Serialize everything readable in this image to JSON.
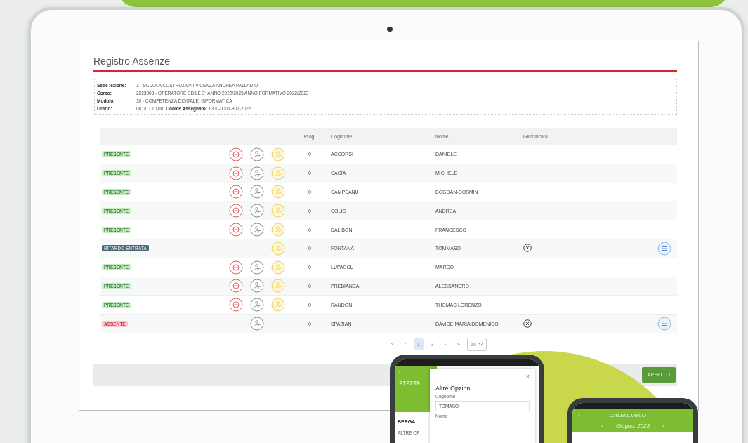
{
  "screen": {
    "title": "Registro Assenze",
    "info": [
      {
        "label": "Sede lezione:",
        "value": "1 - SCUOLA COSTRUZIONI VICENZA ANDREA PALLADIO"
      },
      {
        "label": "Corso:",
        "value": "2223003 - OPERATORE EDILE 3° ANNO 2022/2023 ANNO FORMATIVO 2022/2023"
      },
      {
        "label": "Modulo:",
        "value": "10 - COMPETENZA DIGITALE: INFORMATICA"
      },
      {
        "label": "Orario:",
        "value": "08,00 - 10,00",
        "extra_label": "Codice Assegnato:",
        "extra_value": "1300-0001-807-2022"
      }
    ]
  },
  "table": {
    "columns": [
      "Prog.",
      "Cognome",
      "Nome",
      "Giustificato"
    ],
    "rows": [
      {
        "status": "PRESENTE",
        "kind": "present",
        "remove": true,
        "attendance": true,
        "late": true,
        "prog": "0",
        "cognome": "ACCORSI",
        "nome": "DANIELE",
        "not_justified": false,
        "menu_button": false
      },
      {
        "status": "PRESENTE",
        "kind": "present",
        "remove": true,
        "attendance": true,
        "late": true,
        "prog": "0",
        "cognome": "CACIA",
        "nome": "MICHELE",
        "not_justified": false,
        "menu_button": false
      },
      {
        "status": "PRESENTE",
        "kind": "present",
        "remove": true,
        "attendance": true,
        "late": true,
        "prog": "0",
        "cognome": "CAMPEANU",
        "nome": "BOGDAN-COSMIN",
        "not_justified": false,
        "menu_button": false
      },
      {
        "status": "PRESENTE",
        "kind": "present",
        "remove": true,
        "attendance": true,
        "late": true,
        "prog": "0",
        "cognome": "COLIC",
        "nome": "ANDREA",
        "not_justified": false,
        "menu_button": false
      },
      {
        "status": "PRESENTE",
        "kind": "present",
        "remove": true,
        "attendance": true,
        "late": true,
        "prog": "0",
        "cognome": "DAL BON",
        "nome": "FRANCESCO",
        "not_justified": false,
        "menu_button": false
      },
      {
        "status": "RITARDO ENTRATA",
        "kind": "late",
        "remove": false,
        "attendance": false,
        "late": true,
        "prog": "0",
        "cognome": "FONTANA",
        "nome": "TOMMASO",
        "not_justified": true,
        "menu_button": true
      },
      {
        "status": "PRESENTE",
        "kind": "present",
        "remove": true,
        "attendance": true,
        "late": true,
        "prog": "0",
        "cognome": "LUPASCU",
        "nome": "MARCO",
        "not_justified": false,
        "menu_button": false
      },
      {
        "status": "PRESENTE",
        "kind": "present",
        "remove": true,
        "attendance": true,
        "late": true,
        "prog": "0",
        "cognome": "PREBIANCA",
        "nome": "ALESSANDRO",
        "not_justified": false,
        "menu_button": false
      },
      {
        "status": "PRESENTE",
        "kind": "present",
        "remove": true,
        "attendance": true,
        "late": true,
        "prog": "0",
        "cognome": "RANDON",
        "nome": "THOMAS LORENZO",
        "not_justified": false,
        "menu_button": false
      },
      {
        "status": "ASSENTE",
        "kind": "absent",
        "remove": false,
        "attendance": true,
        "late": false,
        "prog": "0",
        "cognome": "SPAZIAN",
        "nome": "DAVIDE MARIA DOMENICO",
        "not_justified": true,
        "menu_button": true
      }
    ]
  },
  "pagination": {
    "first": "«",
    "prev": "‹",
    "pages": [
      {
        "label": "1",
        "selected": true
      },
      {
        "label": "2",
        "selected": false
      }
    ],
    "next": "›",
    "last": "»",
    "page_size": "10"
  },
  "footer_button": "APPELLO",
  "phone_dialog": {
    "back": "‹",
    "code": "212299",
    "list_title": "BERGA",
    "list_item": "ALTRE OP",
    "dialog_title": "Altre Opzioni",
    "close": "×",
    "field_label_1": "Cognome",
    "field_value_1": "TOMASO",
    "field_label_2": "Nome"
  },
  "phone_calendar": {
    "back": "‹",
    "title": "CALENDARIO",
    "prev": "‹",
    "month": "Giugno, 2023",
    "next": "›"
  }
}
